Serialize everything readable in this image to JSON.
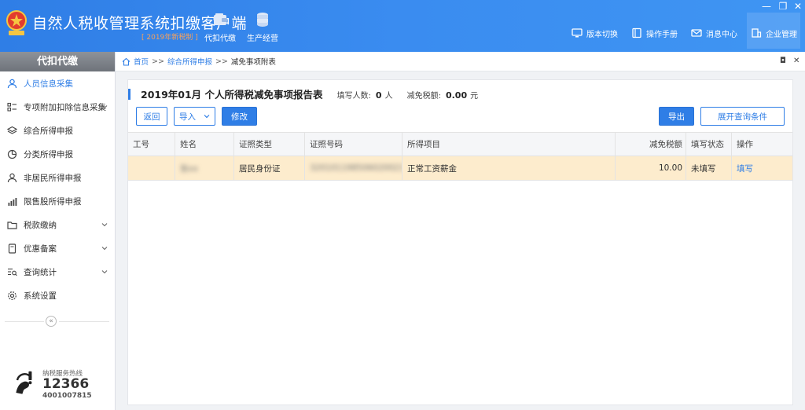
{
  "header": {
    "title": "自然人税收管理系统扣缴客户端",
    "subtitle": "[ 2019年新税制 ]",
    "nav_big": [
      {
        "label": "代扣代缴",
        "icon": "wallet-icon"
      },
      {
        "label": "生产经营",
        "icon": "coin-stack-icon"
      }
    ],
    "nav_right": [
      {
        "label": "版本切换",
        "icon": "monitor-icon"
      },
      {
        "label": "操作手册",
        "icon": "book-icon"
      },
      {
        "label": "消息中心",
        "icon": "mail-icon"
      },
      {
        "label": "企业管理",
        "icon": "building-icon"
      }
    ],
    "window_controls": {
      "minimize": "—",
      "restore": "❐",
      "close": "✕"
    }
  },
  "sidebar": {
    "heading": "代扣代缴",
    "items": [
      {
        "label": "人员信息采集",
        "icon": "person-icon",
        "active": true,
        "expandable": false
      },
      {
        "label": "专项附加扣除信息采集",
        "icon": "list-icon",
        "active": false,
        "expandable": true
      },
      {
        "label": "综合所得申报",
        "icon": "layers-icon",
        "active": false,
        "expandable": false
      },
      {
        "label": "分类所得申报",
        "icon": "pie-icon",
        "active": false,
        "expandable": false
      },
      {
        "label": "非居民所得申报",
        "icon": "person-outline-icon",
        "active": false,
        "expandable": false
      },
      {
        "label": "限售股所得申报",
        "icon": "bar-chart-icon",
        "active": false,
        "expandable": false
      },
      {
        "label": "税款缴纳",
        "icon": "folder-icon",
        "active": false,
        "expandable": true
      },
      {
        "label": "优惠备案",
        "icon": "document-icon",
        "active": false,
        "expandable": true
      },
      {
        "label": "查询统计",
        "icon": "search-list-icon",
        "active": false,
        "expandable": true
      },
      {
        "label": "系统设置",
        "icon": "gear-icon",
        "active": false,
        "expandable": false
      }
    ],
    "collapse_glyph": "«",
    "hotline": {
      "label": "纳税服务热线",
      "number": "12366",
      "number2": "4001007815"
    }
  },
  "breadcrumb": {
    "items": [
      "首页",
      "综合所得申报",
      "减免事项附表"
    ],
    "separator": ">>",
    "controls": {
      "restore": "◘",
      "close": "✕"
    }
  },
  "report": {
    "title": "2019年01月  个人所得税减免事项报告表",
    "count_label": "填写人数:",
    "count_value": "0",
    "count_unit": "人",
    "amount_label": "减免税额:",
    "amount_value": "0.00",
    "amount_unit": "元"
  },
  "toolbar": {
    "back": "返回",
    "import": "导入",
    "modify": "修改",
    "export": "导出",
    "expand_query": "展开查询条件"
  },
  "table": {
    "headers": [
      "工号",
      "姓名",
      "证照类型",
      "证照号码",
      "所得项目",
      "减免税额",
      "填写状态",
      "操作"
    ],
    "rows": [
      {
        "id": "",
        "name": "张xx",
        "id_type": "居民身份证",
        "id_number": "320101198506020021",
        "income_item": "正常工资薪金",
        "amount": "10.00",
        "status": "未填写",
        "action": "填写"
      }
    ]
  },
  "colors": {
    "accent": "#2f7ee6",
    "selected_row": "#fdeccd",
    "subtitle": "#f7a15c"
  }
}
